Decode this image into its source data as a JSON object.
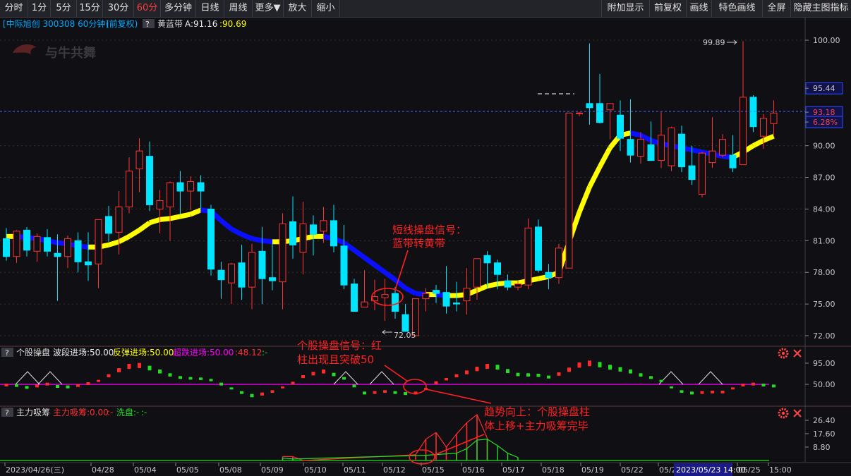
{
  "toolbar": {
    "periods": [
      "分时",
      "1分",
      "5分",
      "15分",
      "30分",
      "60分",
      "多分钟",
      "日线",
      "周线",
      "更多▼",
      "放大",
      "缩小"
    ],
    "active_period": "60分",
    "right_buttons": [
      "附加显示",
      "前复权",
      "画线",
      "特色画线",
      "全屏",
      "隐藏主图指标"
    ]
  },
  "main_panel": {
    "title": "[中际旭创 300308 60分钟]",
    "adjust": "(前复权)",
    "help_label": "?",
    "indicator_name": "黄蓝带",
    "indicator_a": "A:91.16",
    "indicator_b": ":90.69",
    "logo_text": "与牛共舞",
    "price_ticks": [
      "100.00",
      "95.44",
      "93.18",
      "6.28%",
      "90.00",
      "87.00",
      "84.00",
      "81.00",
      "78.00",
      "75.00",
      "72.00"
    ],
    "high_label": "99.89",
    "low_label": "72.05",
    "annotation_1_line1": "短线操盘信号：",
    "annotation_1_line2": "蓝带转黄带"
  },
  "panel_2": {
    "help_label": "?",
    "name": "个股操盘",
    "v1": "波段进场:50.00",
    "v2": "反弹进场:50.00",
    "v3": "超跌进场:50.00",
    "v4": ":48.12",
    "v5": ":-",
    "ticks": [
      "95.00",
      "50.00"
    ],
    "annotation_line1": "个股操盘信号：红",
    "annotation_line2": "柱出现且突破50"
  },
  "panel_3": {
    "help_label": "?",
    "name": "主力吸筹",
    "v1": "主力吸筹:0.00",
    "v2": ":-",
    "v3": "洗盘:-",
    "v4": ":-",
    "ticks": [
      "26.40",
      "17.60",
      "8.80"
    ],
    "annotation_line1": "趋势向上：个股操盘柱",
    "annotation_line2": "体上移+主力吸筹完毕"
  },
  "date_axis": {
    "labels": [
      "2023/04/26(三)",
      "04/28",
      "05/04",
      "05/05",
      "05/08",
      "05/09",
      "05/10",
      "05/11",
      "05/12",
      "05/15",
      "05/16",
      "05/17",
      "05/18",
      "05/19",
      "05/22",
      "05/2",
      "05/25",
      "15:00"
    ],
    "cursor_label": "2023/05/23 14:00"
  },
  "chart_data": {
    "type": "candlestick",
    "main_ylim": [
      71,
      102
    ],
    "candles": [
      [
        81.2,
        82.2,
        79.1,
        79.5
      ],
      [
        79.5,
        82.0,
        78.9,
        81.9
      ],
      [
        82.0,
        82.3,
        79.5,
        80.1
      ],
      [
        80.0,
        81.7,
        79.0,
        81.4
      ],
      [
        81.3,
        82.1,
        79.5,
        80.0
      ],
      [
        79.8,
        81.6,
        75.3,
        79.5
      ],
      [
        79.5,
        81.5,
        78.4,
        81.2
      ],
      [
        81.0,
        81.8,
        78.0,
        79.0
      ],
      [
        79.0,
        81.8,
        77.2,
        78.7
      ],
      [
        78.8,
        82.9,
        76.5,
        83.0
      ],
      [
        83.3,
        84.3,
        80.9,
        81.7
      ],
      [
        81.8,
        85.7,
        79.7,
        84.2
      ],
      [
        84.2,
        88.9,
        83.6,
        87.6
      ],
      [
        87.8,
        90.7,
        85.6,
        89.5
      ],
      [
        89.0,
        90.4,
        83.8,
        84.4
      ],
      [
        84.0,
        85.8,
        81.7,
        84.8
      ],
      [
        84.2,
        86.6,
        81.0,
        86.5
      ],
      [
        86.5,
        87.6,
        83.5,
        85.7
      ],
      [
        85.7,
        87.1,
        83.9,
        86.6
      ],
      [
        86.5,
        87.2,
        84.0,
        85.7
      ],
      [
        84.0,
        84.4,
        77.7,
        78.3
      ],
      [
        78.2,
        79.0,
        75.5,
        77.3
      ],
      [
        77.0,
        78.9,
        75.0,
        78.8
      ],
      [
        78.9,
        80.6,
        75.4,
        76.6
      ],
      [
        76.6,
        80.7,
        74.5,
        79.9
      ],
      [
        80.0,
        82.3,
        75.0,
        77.4
      ],
      [
        77.5,
        80.7,
        76.3,
        77.2
      ],
      [
        77.1,
        83.6,
        74.5,
        82.6
      ],
      [
        82.8,
        85.2,
        79.3,
        80.6
      ],
      [
        79.9,
        84.7,
        77.8,
        82.6
      ],
      [
        82.5,
        83.4,
        79.6,
        81.6
      ],
      [
        81.9,
        84.2,
        80.8,
        82.9
      ],
      [
        82.9,
        84.4,
        79.9,
        80.5
      ],
      [
        80.5,
        82.5,
        76.4,
        76.8
      ],
      [
        76.9,
        77.4,
        74.9,
        74.3
      ],
      [
        74.7,
        78.2,
        74.7,
        75.2
      ],
      [
        75.3,
        77.3,
        74.4,
        75.7
      ],
      [
        75.6,
        77.4,
        73.4,
        75.9
      ],
      [
        76.0,
        76.6,
        73.6,
        74.3
      ],
      [
        74.0,
        75.0,
        73.0,
        72.4
      ],
      [
        72.0,
        74.9,
        72.0,
        75.5
      ],
      [
        75.5,
        76.5,
        74.3,
        76.0
      ],
      [
        76.3,
        76.8,
        75.1,
        76.0
      ],
      [
        76.1,
        78.6,
        74.1,
        74.8
      ],
      [
        75.1,
        77.1,
        74.3,
        75.0
      ],
      [
        75.3,
        78.4,
        74.0,
        76.5
      ],
      [
        76.6,
        78.4,
        75.4,
        79.3
      ],
      [
        79.6,
        80.0,
        76.5,
        78.9
      ],
      [
        78.9,
        79.2,
        76.4,
        77.8
      ],
      [
        77.2,
        77.8,
        76.3,
        76.6
      ],
      [
        76.6,
        77.2,
        76.3,
        76.9
      ],
      [
        76.8,
        83.1,
        76.4,
        82.2
      ],
      [
        82.3,
        83.0,
        78.0,
        78.2
      ],
      [
        78.0,
        78.8,
        76.4,
        77.5
      ],
      [
        77.5,
        80.7,
        76.9,
        80.3
      ],
      [
        78.4,
        93.0,
        85.6,
        93.1
      ],
      [
        93.1,
        93.2,
        92.8,
        93.1
      ],
      [
        94.0,
        99.7,
        92.0,
        93.6
      ],
      [
        94.0,
        96.8,
        92.1,
        92.2
      ],
      [
        93.4,
        94.0,
        90.6,
        94.0
      ],
      [
        92.9,
        94.3,
        89.5,
        90.7
      ],
      [
        90.6,
        94.4,
        88.4,
        89.1
      ],
      [
        89.0,
        91.3,
        88.3,
        90.6
      ],
      [
        90.1,
        92.3,
        89.2,
        88.6
      ],
      [
        88.6,
        93.2,
        87.9,
        91.0
      ],
      [
        88.1,
        91.8,
        87.6,
        91.7
      ],
      [
        91.1,
        91.9,
        87.5,
        88.0
      ],
      [
        88.1,
        90.0,
        86.3,
        86.8
      ],
      [
        85.4,
        89.4,
        85.1,
        89.3
      ],
      [
        88.4,
        92.7,
        87.9,
        89.5
      ],
      [
        89.1,
        91.1,
        88.9,
        90.6
      ],
      [
        89.1,
        91.0,
        87.5,
        87.9
      ],
      [
        88.2,
        99.9,
        89.3,
        94.6
      ],
      [
        94.6,
        94.8,
        91.3,
        91.8
      ],
      [
        90.9,
        93.0,
        89.7,
        92.6
      ],
      [
        92.1,
        94.3,
        91.0,
        93.1
      ]
    ],
    "band": [
      81.4,
      81.4,
      81.3,
      81.2,
      81.0,
      80.8,
      80.7,
      80.5,
      80.4,
      80.4,
      80.6,
      80.9,
      81.4,
      82.0,
      82.7,
      83.0,
      83.1,
      83.3,
      83.5,
      83.9,
      83.8,
      82.9,
      82.1,
      81.6,
      81.2,
      81.0,
      80.9,
      80.9,
      81.0,
      81.2,
      81.4,
      81.4,
      81.2,
      80.8,
      80.1,
      79.4,
      78.7,
      78.0,
      77.3,
      76.5,
      76.0,
      75.9,
      75.9,
      75.8,
      75.8,
      75.9,
      76.3,
      76.7,
      76.9,
      77.0,
      77.0,
      77.2,
      77.4,
      77.6,
      78.0,
      80.9,
      83.7,
      86.1,
      88.0,
      89.8,
      91.0,
      91.2,
      91.0,
      90.5,
      90.2,
      90.0,
      89.8,
      89.6,
      89.4,
      89.2,
      89.0,
      88.9,
      89.4,
      90.0,
      90.5,
      90.9
    ],
    "panel2_series": [
      [
        0,
        50
      ],
      [
        1,
        49
      ],
      [
        2,
        45
      ],
      [
        3,
        48
      ],
      [
        4,
        52
      ],
      [
        5,
        47
      ],
      [
        6,
        46
      ],
      [
        7,
        49
      ],
      [
        8,
        53
      ],
      [
        9,
        58
      ],
      [
        10,
        70
      ],
      [
        11,
        83
      ],
      [
        12,
        92
      ],
      [
        13,
        94
      ],
      [
        14,
        88
      ],
      [
        15,
        80
      ],
      [
        16,
        72
      ],
      [
        17,
        66
      ],
      [
        18,
        64
      ],
      [
        19,
        63
      ],
      [
        20,
        60
      ],
      [
        21,
        52
      ],
      [
        22,
        42
      ],
      [
        23,
        34
      ],
      [
        24,
        28
      ],
      [
        25,
        31
      ],
      [
        26,
        36
      ],
      [
        27,
        44
      ],
      [
        28,
        54
      ],
      [
        29,
        68
      ],
      [
        30,
        75
      ],
      [
        31,
        80
      ],
      [
        32,
        73
      ],
      [
        33,
        64
      ],
      [
        34,
        48
      ],
      [
        35,
        33
      ],
      [
        36,
        34
      ],
      [
        37,
        36
      ],
      [
        38,
        34
      ],
      [
        39,
        32
      ],
      [
        40,
        33
      ],
      [
        41,
        41
      ],
      [
        42,
        55
      ],
      [
        43,
        62
      ],
      [
        44,
        70
      ],
      [
        45,
        78
      ],
      [
        46,
        86
      ],
      [
        47,
        92
      ],
      [
        48,
        90
      ],
      [
        49,
        81
      ],
      [
        50,
        73
      ],
      [
        51,
        72
      ],
      [
        52,
        71
      ],
      [
        53,
        67
      ],
      [
        54,
        74
      ],
      [
        55,
        84
      ],
      [
        56,
        95
      ],
      [
        57,
        99
      ],
      [
        58,
        96
      ],
      [
        59,
        90
      ],
      [
        60,
        85
      ],
      [
        61,
        80
      ],
      [
        62,
        72
      ],
      [
        63,
        66
      ],
      [
        64,
        58
      ],
      [
        65,
        44
      ],
      [
        66,
        36
      ],
      [
        67,
        33
      ],
      [
        68,
        34
      ],
      [
        69,
        35
      ],
      [
        70,
        35
      ],
      [
        71,
        42
      ],
      [
        72,
        50
      ],
      [
        73,
        52
      ],
      [
        74,
        50
      ],
      [
        75,
        48
      ]
    ],
    "panel3_red": [
      [
        27,
        2.6
      ],
      [
        28,
        2.6
      ],
      [
        29,
        0
      ],
      [
        40,
        3.8
      ],
      [
        41,
        14
      ],
      [
        42,
        18.4
      ],
      [
        43,
        8.8
      ],
      [
        44,
        17.4
      ],
      [
        45,
        24.8
      ],
      [
        46,
        30.2
      ],
      [
        47,
        14.6
      ]
    ],
    "panel3_green": [
      [
        27,
        1.6
      ],
      [
        28,
        1.0
      ],
      [
        41,
        3.4
      ],
      [
        44,
        4.8
      ],
      [
        45,
        7.8
      ],
      [
        46,
        13.4
      ],
      [
        47,
        14.0
      ],
      [
        48,
        9.8
      ],
      [
        49,
        4.8
      ],
      [
        50,
        2.0
      ]
    ]
  },
  "colors": {
    "up_candle": "#ff3232",
    "down_candle": "#00e5ff",
    "blue_band": "#0a10ff",
    "yellow_band": "#ffff00",
    "accent": "#ff3c3c",
    "magenta": "#ff00ff",
    "grid_line": "#3a2f2f"
  }
}
